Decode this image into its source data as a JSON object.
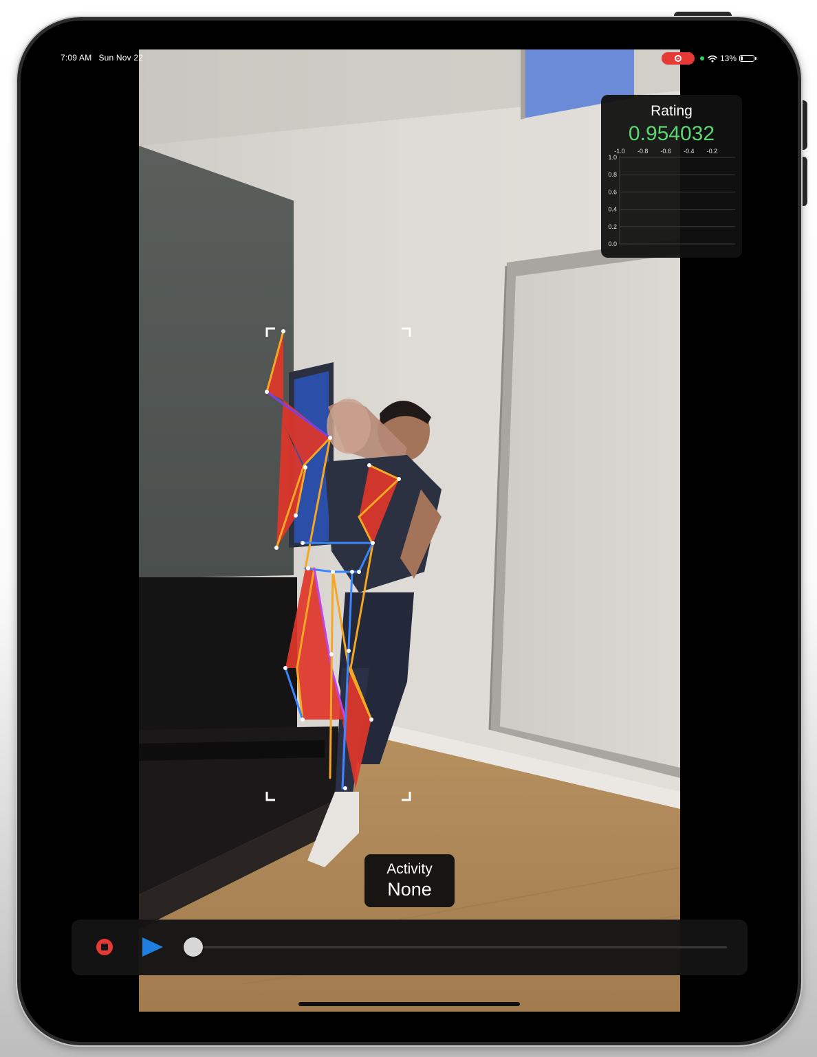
{
  "status_bar": {
    "time": "7:09 AM",
    "date": "Sun Nov 22",
    "battery": "13%",
    "battery_level": 0.13,
    "icons": [
      "screen-record-icon",
      "camera-indicator-icon",
      "wifi-icon",
      "battery-icon"
    ]
  },
  "rating": {
    "title": "Rating",
    "value": "0.954032",
    "value_color": "#5bd671",
    "chart_data": {
      "type": "line",
      "x_ticks": [
        "-1.0",
        "-0.8",
        "-0.6",
        "-0.4",
        "-0.2"
      ],
      "y_ticks": [
        "1.0",
        "0.8",
        "0.6",
        "0.4",
        "0.2",
        "0.0"
      ],
      "xlim": [
        -1.0,
        0.0
      ],
      "ylim": [
        0.0,
        1.0
      ],
      "series": [],
      "grid": true
    }
  },
  "activity": {
    "label": "Activity",
    "value": "None"
  },
  "controls": {
    "record_color": "#e53935",
    "play_color": "#1f7fe0",
    "progress": 0.0
  },
  "overlay": {
    "skeleton_colors": [
      "#e5382c",
      "#f5a623",
      "#3a86ff",
      "#c145e8"
    ]
  }
}
